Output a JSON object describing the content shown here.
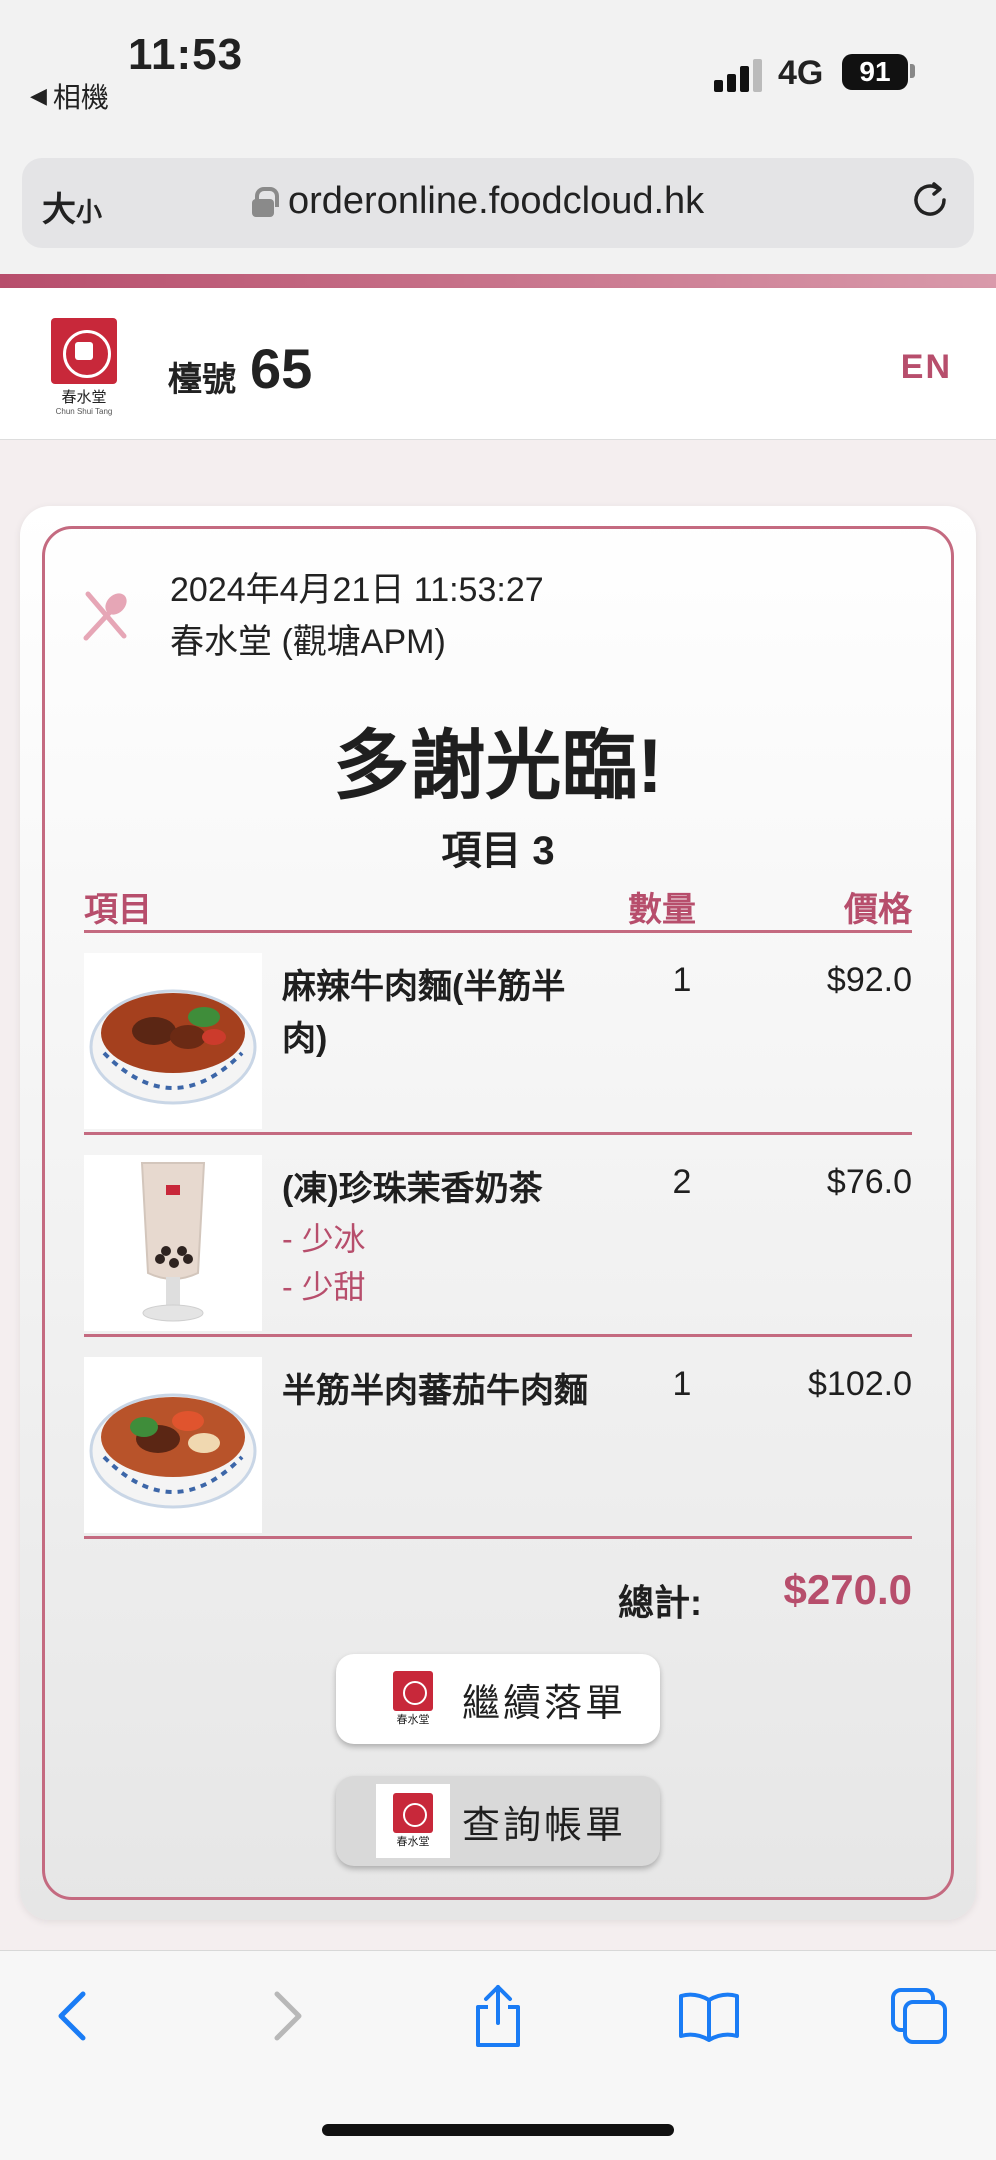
{
  "status_bar": {
    "time": "11:53",
    "back_app": "相機",
    "network": "4G",
    "battery": "91"
  },
  "browser": {
    "text_size_label": "大",
    "text_size_small": "小",
    "url": "orderonline.foodcloud.hk"
  },
  "header": {
    "logo_text": "春水堂",
    "logo_sub": "Chun Shui Tang",
    "table_label": "檯號",
    "table_number": "65",
    "language": "EN"
  },
  "order": {
    "datetime": "2024年4月21日 11:53:27",
    "store": "春水堂 (觀塘APM)",
    "thanks": "多謝光臨!",
    "item_count": "項目 3",
    "columns": {
      "item": "項目",
      "qty": "數量",
      "price": "價格"
    },
    "items": [
      {
        "name": "麻辣牛肉麵(半筋半肉)",
        "modifiers": [],
        "qty": "1",
        "price": "$92.0",
        "image": "noodle-bowl-spicy"
      },
      {
        "name": "(凍)珍珠茉香奶茶",
        "modifiers": [
          "- 少冰",
          "- 少甜"
        ],
        "qty": "2",
        "price": "$76.0",
        "image": "bubble-milk-tea"
      },
      {
        "name": "半筋半肉蕃茄牛肉麵",
        "modifiers": [],
        "qty": "1",
        "price": "$102.0",
        "image": "noodle-bowl-tomato"
      }
    ],
    "total_label": "總計:",
    "total_value": "$270.0"
  },
  "actions": {
    "continue_label": "繼續落單",
    "bill_label": "查詢帳單"
  },
  "colors": {
    "accent": "#b74e6c",
    "logo_red": "#c8283a",
    "ios_blue": "#1a7cf5"
  },
  "toolbar_icons": [
    "back-icon",
    "forward-icon",
    "share-icon",
    "bookmarks-icon",
    "tabs-icon"
  ]
}
